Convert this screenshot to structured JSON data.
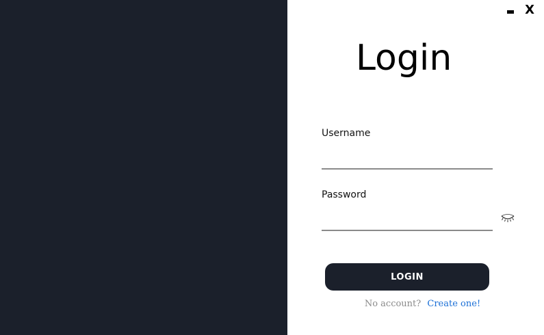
{
  "window": {
    "minimize_label": "",
    "close_label": "X"
  },
  "login": {
    "title": "Login",
    "username_label": "Username",
    "username_value": "",
    "password_label": "Password",
    "password_value": "",
    "submit_label": "LOGIN",
    "no_account_text": "No account?",
    "create_link_text": "Create one!"
  },
  "icons": {
    "password_toggle": "eye-closed-icon"
  },
  "colors": {
    "panel_dark": "#1b202b",
    "background": "#ffffff",
    "input_underline": "#8a8a8a",
    "link": "#1a6fd6",
    "muted_text": "#8a8a8a"
  }
}
